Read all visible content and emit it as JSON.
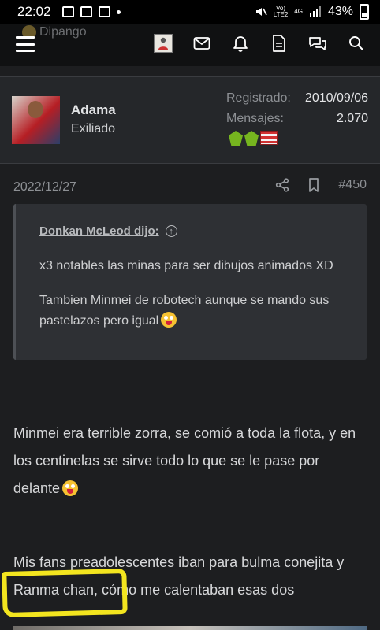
{
  "status_bar": {
    "time": "22:02",
    "network_top": "Vo)",
    "network_bottom": "LTE2",
    "network_type": "4G",
    "battery": "43%"
  },
  "nav": {
    "ghost_title": "Dipango",
    "icons": [
      "menu-icon",
      "avatar",
      "mail-icon",
      "bell-icon",
      "document-icon",
      "chat-icon",
      "search-icon"
    ]
  },
  "user": {
    "name": "Adama",
    "title": "Exiliado",
    "registered_label": "Registrado:",
    "registered_value": "2010/09/06",
    "messages_label": "Mensajes:",
    "messages_value": "2.070"
  },
  "post": {
    "date": "2022/12/27",
    "number": "#450",
    "quote": {
      "author": "Donkan McLeod dijo:",
      "line1": "x3 notables las minas para ser dibujos animados XD",
      "line2": "Tambien Minmei de robotech aunque se mando sus pastelazos pero igual"
    },
    "paragraph1": "Minmei era terrible zorra, se comió a toda la flota, y en los centinelas se sirve todo lo que se le pase por delante",
    "paragraph2": "Mis fans preadolescentes iban para bulma conejita y Ranma chan, cómo me calentaban esas dos"
  },
  "colors": {
    "background": "#1d1e20",
    "user_bar": "#25272a",
    "quote_bg": "#2e3034",
    "highlight": "#f3e51f",
    "trophy_green": "#76b51f"
  }
}
